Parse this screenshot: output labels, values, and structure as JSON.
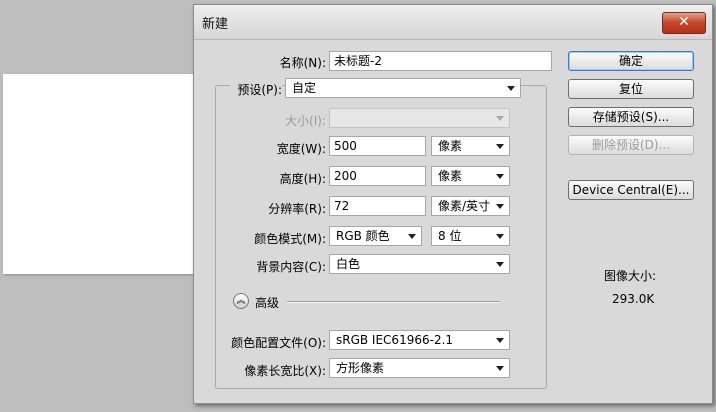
{
  "dialog": {
    "title": "新建",
    "close_label": "✕"
  },
  "form": {
    "name": {
      "label": "名称(N):",
      "value": "未标题-2"
    },
    "preset": {
      "label": "预设(P):",
      "value": "自定"
    },
    "size": {
      "label": "大小(I):",
      "value": ""
    },
    "width": {
      "label": "宽度(W):",
      "value": "500",
      "unit": "像素"
    },
    "height": {
      "label": "高度(H):",
      "value": "200",
      "unit": "像素"
    },
    "resolution": {
      "label": "分辨率(R):",
      "value": "72",
      "unit": "像素/英寸"
    },
    "color_mode": {
      "label": "颜色模式(M):",
      "value": "RGB 颜色",
      "depth": "8 位"
    },
    "background": {
      "label": "背景内容(C):",
      "value": "白色"
    },
    "advanced": {
      "label": "高级",
      "toggle_icon": "︽"
    },
    "color_profile": {
      "label": "颜色配置文件(O):",
      "value": "sRGB IEC61966-2.1"
    },
    "pixel_aspect": {
      "label": "像素长宽比(X):",
      "value": "方形像素"
    }
  },
  "buttons": {
    "ok": "确定",
    "reset": "复位",
    "save_preset": "存储预设(S)...",
    "delete_preset": "删除预设(D)...",
    "device_central": "Device Central(E)..."
  },
  "image_size": {
    "label": "图像大小:",
    "value": "293.0K"
  }
}
